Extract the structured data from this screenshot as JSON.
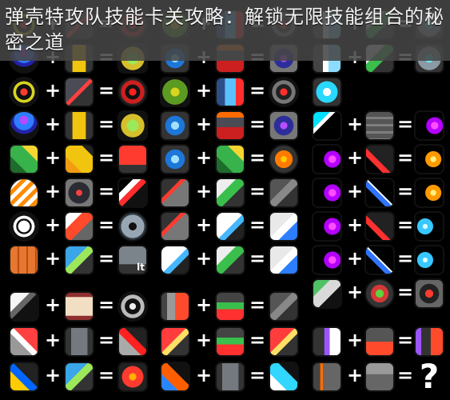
{
  "title": "弹壳特攻队技能卡关攻略：解锁无限技能组合的秘密之道",
  "symbols": {
    "plus": "+",
    "equals": "=",
    "unknown": "?"
  },
  "items": {
    "weight": "lt"
  },
  "colors": {
    "background": "#000000",
    "title_overlay": "#464646",
    "text": "#ffffff"
  }
}
